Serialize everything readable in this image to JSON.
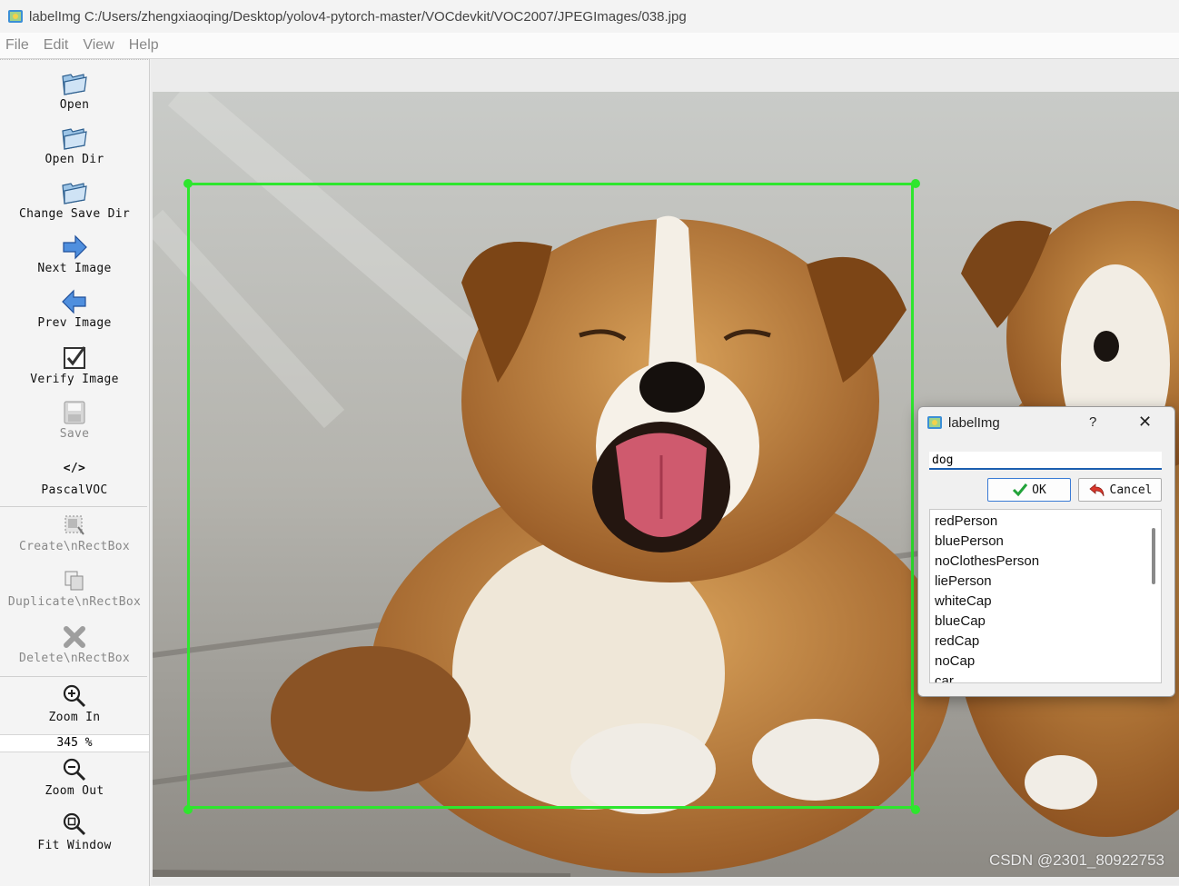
{
  "window": {
    "title": "labelImg C:/Users/zhengxiaoqing/Desktop/yolov4-pytorch-master/VOCdevkit/VOC2007/JPEGImages/038.jpg"
  },
  "menu": {
    "items": [
      "File",
      "Edit",
      "View",
      "Help"
    ]
  },
  "toolbar": {
    "open": "Open",
    "open_dir": "Open Dir",
    "change_save_dir": "Change Save Dir",
    "next_image": "Next Image",
    "prev_image": "Prev Image",
    "verify_image": "Verify Image",
    "save": "Save",
    "format_icon_text": "</>",
    "format": "PascalVOC",
    "create_rect": "Create\\nRectBox",
    "duplicate_rect": "Duplicate\\nRectBox",
    "delete_rect": "Delete\\nRectBox",
    "zoom_in": "Zoom In",
    "zoom_value": "345 %",
    "zoom_out": "Zoom Out",
    "fit_window": "Fit Window"
  },
  "canvas": {
    "watermark": "CSDN @2301_80922753",
    "box_color": "#2ee62e"
  },
  "dialog": {
    "title": "labelImg",
    "help": "?",
    "close": "✕",
    "input_value": "dog",
    "ok_label": "OK",
    "cancel_label": "Cancel",
    "labels": [
      "redPerson",
      "bluePerson",
      "noClothesPerson",
      "liePerson",
      "whiteCap",
      "blueCap",
      "redCap",
      "noCap",
      "car"
    ]
  }
}
